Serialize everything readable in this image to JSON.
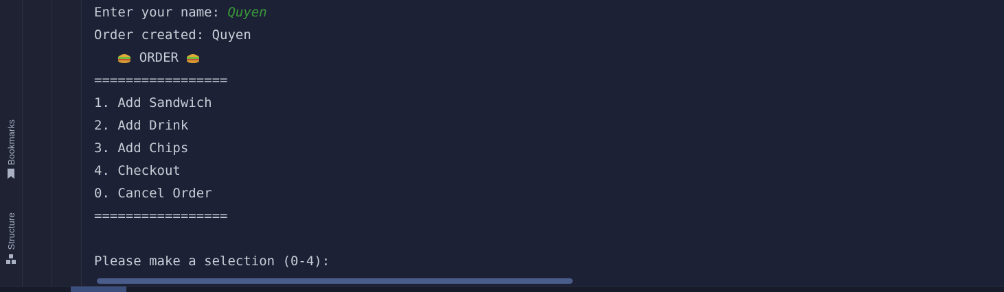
{
  "sidebar": {
    "tabs": [
      {
        "label": "Bookmarks",
        "icon": "bookmark-icon"
      },
      {
        "label": "Structure",
        "icon": "structure-icon"
      }
    ]
  },
  "console": {
    "prompt_name": "Enter your name: ",
    "input_name": "Quyen",
    "order_created": "Order created: Quyen",
    "menu_title": " ORDER ",
    "menu_icon": "sandwich-emoji",
    "separator": "=================",
    "options": [
      "1. Add Sandwich",
      "2. Add Drink",
      "3. Add Chips",
      "4. Checkout",
      "0. Cancel Order"
    ],
    "separator_bottom": "=================",
    "selection_prompt": "Please make a selection (0-4):"
  },
  "colors": {
    "background": "#1c2136",
    "text": "#c9cdd6",
    "user_input": "#3a9b3a",
    "scrollbar": "#4a5c8a"
  }
}
